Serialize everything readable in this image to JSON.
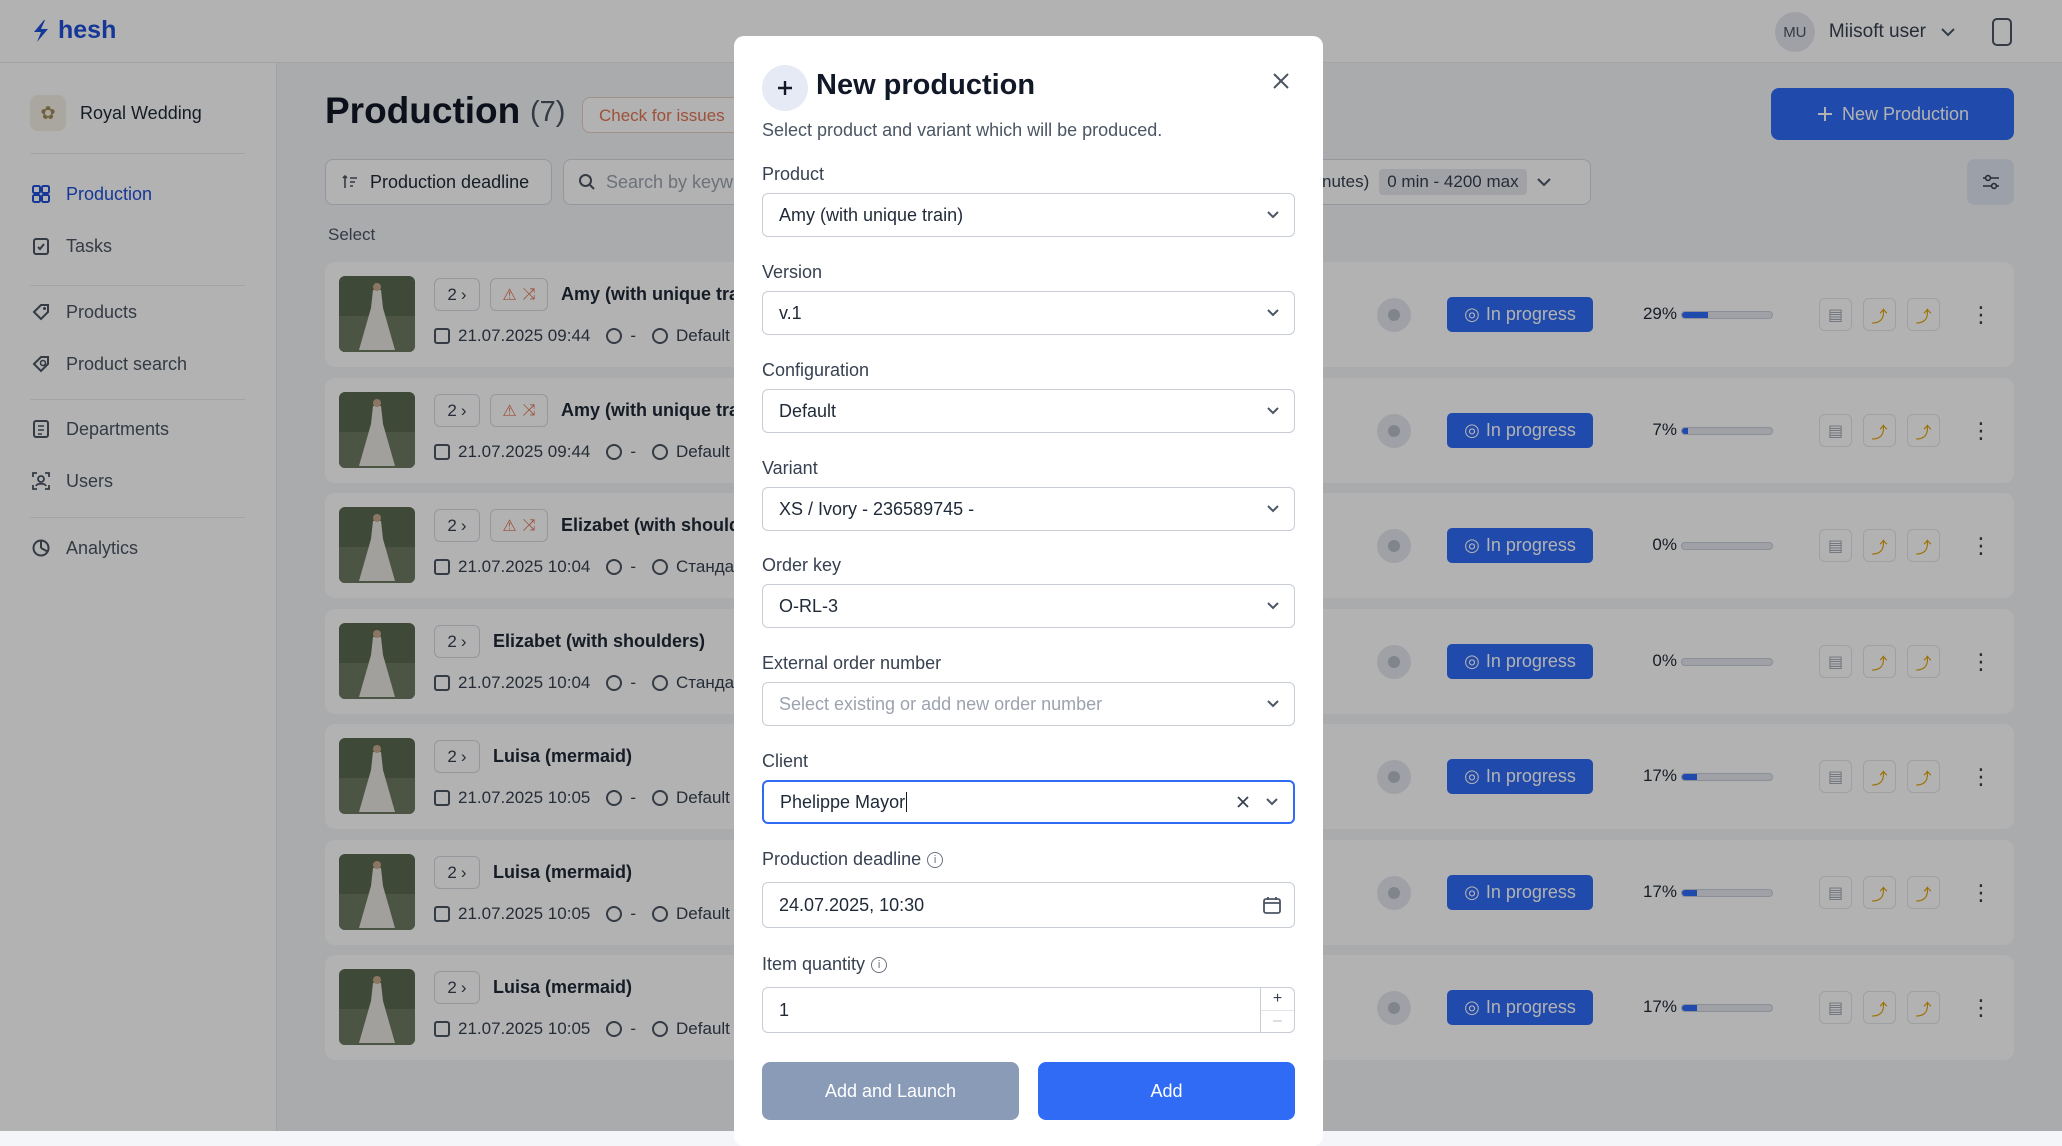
{
  "app": {
    "logo_text": "hesh",
    "brand_color": "#1f4fd8",
    "accent_color": "#2f6bf5"
  },
  "user": {
    "initials": "MU",
    "name": "Miisoft user"
  },
  "sidebar": {
    "workspace": "Royal Wedding",
    "items": [
      {
        "label": "Production",
        "icon": "production-icon",
        "active": true
      },
      {
        "label": "Tasks",
        "icon": "tasks-icon",
        "active": false
      },
      {
        "label": "Products",
        "icon": "products-icon",
        "active": false
      },
      {
        "label": "Product search",
        "icon": "product-search-icon",
        "active": false
      },
      {
        "label": "Departments",
        "icon": "departments-icon",
        "active": false
      },
      {
        "label": "Users",
        "icon": "users-icon",
        "active": false
      },
      {
        "label": "Analytics",
        "icon": "analytics-icon",
        "active": false
      }
    ]
  },
  "main": {
    "title": "Production",
    "count": "(7)",
    "check_issues": "Check for issues",
    "new_production": "New Production",
    "sort_label": "Production deadline",
    "search_placeholder": "Search by keyw",
    "duration_suffix": "nutes)",
    "duration_range": "0 min - 4200 max",
    "select_label": "Select",
    "rows": [
      {
        "qty": "2",
        "title": "Amy (with unique tra",
        "date": "21.07.2025 09:44",
        "dash": "-",
        "config": "Default",
        "status": "In progress",
        "progress": 29,
        "progress_label": "29%",
        "warn": true
      },
      {
        "qty": "2",
        "title": "Amy (with unique tra",
        "date": "21.07.2025 09:44",
        "dash": "-",
        "config": "Default",
        "status": "In progress",
        "progress": 7,
        "progress_label": "7%",
        "warn": true
      },
      {
        "qty": "2",
        "title": "Elizabet (with shoulde",
        "date": "21.07.2025 10:04",
        "dash": "-",
        "config": "Стандар",
        "status": "In progress",
        "progress": 0,
        "progress_label": "0%",
        "warn": true
      },
      {
        "qty": "2",
        "title": "Elizabet (with shoulders)",
        "date": "21.07.2025 10:04",
        "dash": "-",
        "config": "Стандар",
        "status": "In progress",
        "progress": 0,
        "progress_label": "0%",
        "warn": false
      },
      {
        "qty": "2",
        "title": "Luisa (mermaid)",
        "date": "21.07.2025 10:05",
        "dash": "-",
        "config": "Default",
        "status": "In progress",
        "progress": 17,
        "progress_label": "17%",
        "warn": false
      },
      {
        "qty": "2",
        "title": "Luisa (mermaid)",
        "date": "21.07.2025 10:05",
        "dash": "-",
        "config": "Default",
        "status": "In progress",
        "progress": 17,
        "progress_label": "17%",
        "warn": false
      },
      {
        "qty": "2",
        "title": "Luisa (mermaid)",
        "date": "21.07.2025 10:05",
        "dash": "-",
        "config": "Default",
        "status": "In progress",
        "progress": 17,
        "progress_label": "17%",
        "warn": false
      }
    ]
  },
  "modal": {
    "title": "New production",
    "subtitle": "Select product and variant which will be produced.",
    "product": {
      "label": "Product",
      "value": "Amy (with unique train)"
    },
    "version": {
      "label": "Version",
      "value": "v.1"
    },
    "configuration": {
      "label": "Configuration",
      "value": "Default"
    },
    "variant": {
      "label": "Variant",
      "value": "XS / Ivory - 236589745 -"
    },
    "order_key": {
      "label": "Order key",
      "value": "O-RL-3"
    },
    "external_order": {
      "label": "External order number",
      "placeholder": "Select existing or add new order number"
    },
    "client": {
      "label": "Client",
      "value": "Phelippe Mayor"
    },
    "deadline": {
      "label": "Production deadline",
      "value": "24.07.2025, 10:30"
    },
    "quantity": {
      "label": "Item quantity",
      "value": "1"
    },
    "add_launch": "Add and Launch",
    "add": "Add"
  }
}
